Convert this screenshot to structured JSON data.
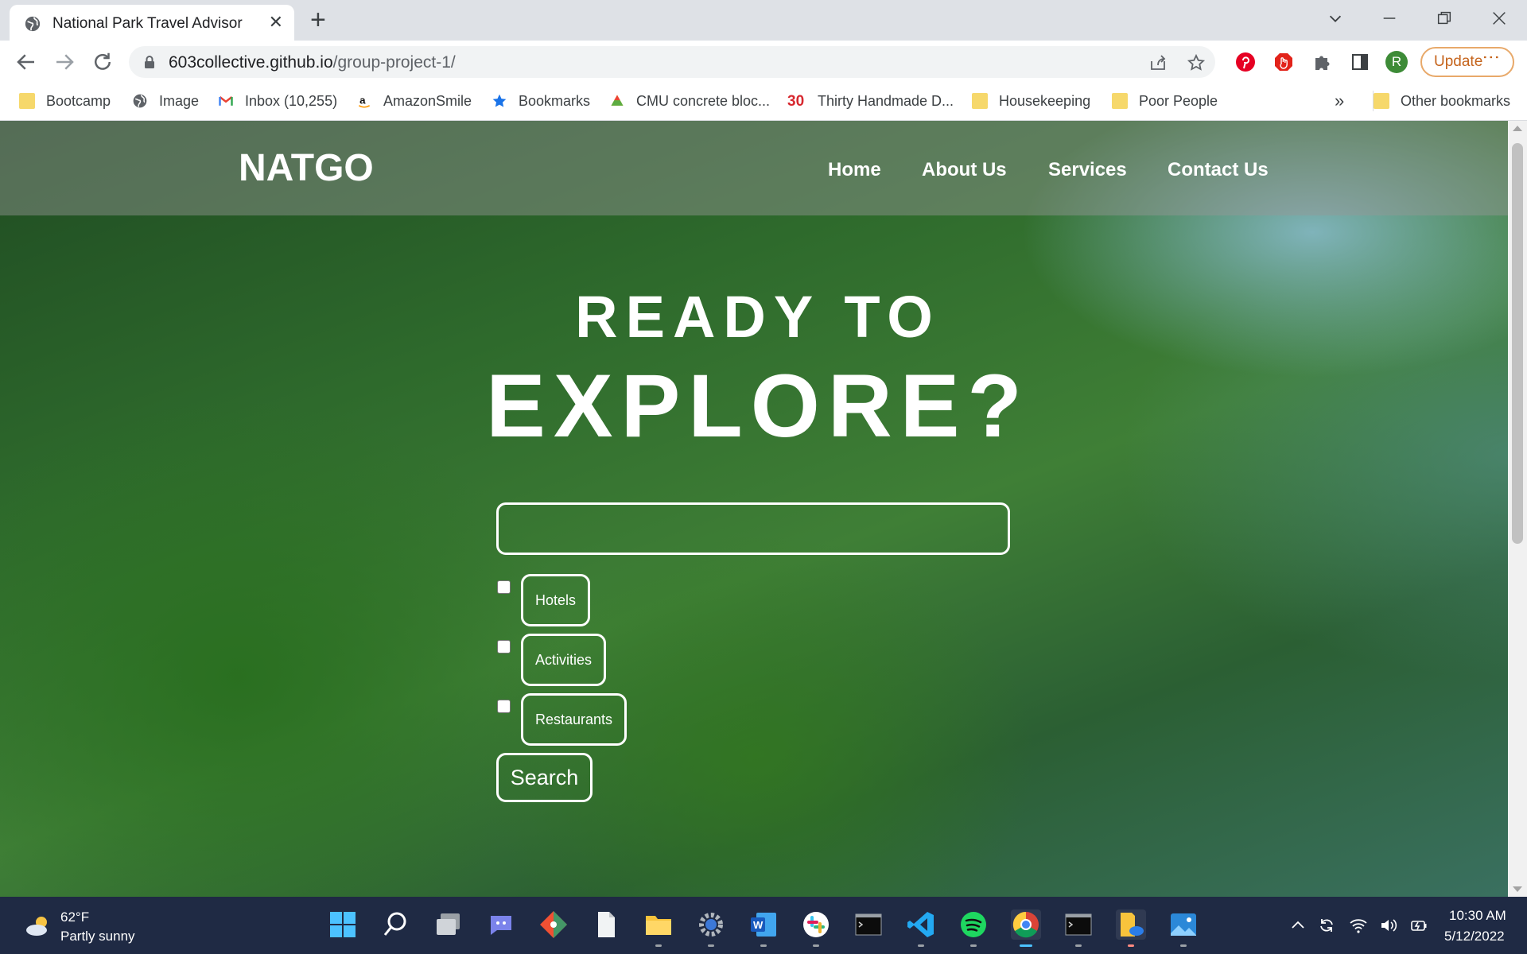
{
  "browser": {
    "tab_title": "National Park Travel Advisor",
    "url_host": "603collective.github.io",
    "url_path": "/group-project-1/",
    "update_label": "Update",
    "avatar_initial": "R"
  },
  "bookmarks": {
    "items": [
      {
        "label": "Bootcamp",
        "icon": "folder-icon"
      },
      {
        "label": "Image",
        "icon": "globe-icon"
      },
      {
        "label": "Inbox (10,255)",
        "icon": "gmail-icon"
      },
      {
        "label": "AmazonSmile",
        "icon": "amazon-icon"
      },
      {
        "label": "Bookmarks",
        "icon": "star-icon"
      },
      {
        "label": "CMU concrete bloc...",
        "icon": "cmu-icon"
      },
      {
        "label": "Thirty Handmade D...",
        "icon": "thirty-icon"
      },
      {
        "label": "Housekeeping",
        "icon": "folder-icon"
      },
      {
        "label": "Poor People",
        "icon": "folder-icon"
      }
    ],
    "overflow": "»",
    "other": "Other bookmarks",
    "thirty_badge": "30"
  },
  "page": {
    "brand": "NATGO",
    "nav": [
      "Home",
      "About Us",
      "Services",
      "Contact Us"
    ],
    "hero_line1": "READY TO",
    "hero_line2": "EXPLORE?",
    "search_value": "",
    "filters": [
      "Hotels",
      "Activities",
      "Restaurants"
    ],
    "search_button": "Search"
  },
  "taskbar": {
    "temperature": "62°F",
    "condition": "Partly sunny",
    "time": "10:30 AM",
    "date": "5/12/2022"
  },
  "colors": {
    "update_accent": "#c5641c",
    "taskbar_bg": "#1f2a44",
    "pinterest": "#e60023",
    "adblock": "#e2231a"
  }
}
